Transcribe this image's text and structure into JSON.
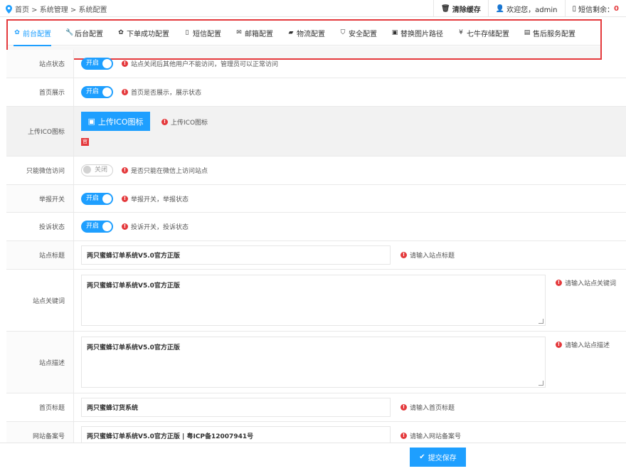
{
  "breadcrumb": {
    "text": "首页 > 系统管理 > 系统配置"
  },
  "topbar": {
    "clear_cache": "清除缓存",
    "welcome": "欢迎您，admin",
    "sms_label": "短信剩余：",
    "sms_count": "0"
  },
  "tabs": [
    {
      "label": "前台配置",
      "icon": "gear-icon",
      "glyph": "✿",
      "active": true
    },
    {
      "label": "后台配置",
      "icon": "wrench-icon",
      "glyph": "🔧"
    },
    {
      "label": "下单成功配置",
      "icon": "gear-icon",
      "glyph": "✿"
    },
    {
      "label": "短信配置",
      "icon": "phone-icon",
      "glyph": "▯"
    },
    {
      "label": "邮箱配置",
      "icon": "envelope-icon",
      "glyph": "✉"
    },
    {
      "label": "物流配置",
      "icon": "truck-icon",
      "glyph": "▰"
    },
    {
      "label": "安全配置",
      "icon": "shield-icon",
      "glyph": "⛉"
    },
    {
      "label": "替换图片路径",
      "icon": "image-icon",
      "glyph": "▣"
    },
    {
      "label": "七牛存储配置",
      "icon": "yen-icon",
      "glyph": "¥"
    },
    {
      "label": "售后服务配置",
      "icon": "briefcase-icon",
      "glyph": "▤"
    }
  ],
  "form": {
    "site_status": {
      "label": "站点状态",
      "switch": "开启",
      "tip": "站点关闭后其他用户不能访问，管理员可以正常访问"
    },
    "home_display": {
      "label": "首页展示",
      "switch": "开启",
      "tip": "首页是否展示，展示状态"
    },
    "upload_ico": {
      "label": "上传ICO图标",
      "button": "上传ICO图标",
      "tip": "上传ICO图标",
      "preview": "官"
    },
    "wechat_only": {
      "label": "只能微信访问",
      "switch": "关闭",
      "tip": "是否只能在微信上访问站点"
    },
    "report_switch": {
      "label": "举报开关",
      "switch": "开启",
      "tip": "举报开关，举报状态"
    },
    "complaint_status": {
      "label": "投诉状态",
      "switch": "开启",
      "tip": "投诉开关，投诉状态"
    },
    "site_title": {
      "label": "站点标题",
      "value": "两只蜜蜂订单系统V5.0官方正版",
      "tip": "请输入站点标题"
    },
    "site_keywords": {
      "label": "站点关键词",
      "value": "两只蜜蜂订单系统V5.0官方正版",
      "tip": "请输入站点关键词"
    },
    "site_description": {
      "label": "站点描述",
      "value": "两只蜜蜂订单系统V5.0官方正版",
      "tip": "请输入站点描述"
    },
    "home_title": {
      "label": "首页标题",
      "value": "两只蜜蜂订货系统",
      "tip": "请输入首页标题"
    },
    "icp": {
      "label": "网站备案号",
      "value": "两只蜜蜂订单系统V5.0官方正版 | 粤ICP备12007941号",
      "tip": "请输入网站备案号"
    }
  },
  "footer": {
    "submit": "提交保存"
  },
  "colors": {
    "accent": "#1e9fff",
    "danger": "#e4393c"
  }
}
